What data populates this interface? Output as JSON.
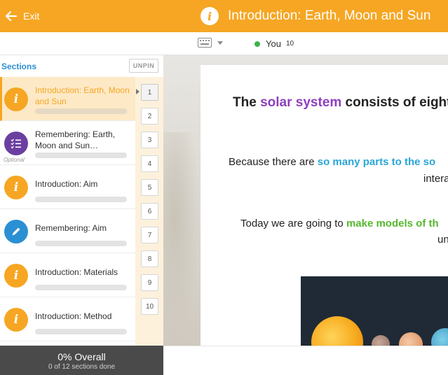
{
  "header": {
    "exit_label": "Exit",
    "title": "Introduction: Earth, Moon and Sun"
  },
  "toolbar": {
    "presence_name": "You",
    "presence_count": "10"
  },
  "sidebar": {
    "heading": "Sections",
    "unpin_label": "UNPIN",
    "items": [
      {
        "label": "Introduction: Earth, Moon and Sun",
        "icon": "info-icon",
        "progress": 0,
        "active": true
      },
      {
        "label": "Remembering: Earth, Moon and Sun…",
        "icon": "checklist-icon",
        "progress": 0,
        "optional_label": "Optional"
      },
      {
        "label": "Introduction: Aim",
        "icon": "info-icon",
        "progress": 0
      },
      {
        "label": "Remembering: Aim",
        "icon": "pencil-icon",
        "progress": 0
      },
      {
        "label": "Introduction: Materials",
        "icon": "info-icon",
        "progress": 0
      },
      {
        "label": "Introduction: Method",
        "icon": "info-icon",
        "progress": 0
      }
    ],
    "pages": [
      "1",
      "2",
      "3",
      "4",
      "5",
      "6",
      "7",
      "8",
      "9",
      "10"
    ],
    "current_page": "1"
  },
  "slide": {
    "heading_pre": "The ",
    "heading_highlight": "solar system",
    "heading_post": " consists of eight p",
    "line2_pre": "Because there are ",
    "line2_highlight": "so many parts to the so",
    "line3": "intera",
    "line4_pre": "Today we are going to ",
    "line4_highlight": "make models of th",
    "line5": "un"
  },
  "footer": {
    "overall_label": "0% Overall",
    "sections_done": "0 of 12 sections done"
  },
  "colors": {
    "brand_orange": "#f6a623",
    "accent_blue": "#2b8fd4",
    "quiz_purple": "#6b3fa0",
    "online_green": "#3bb54a",
    "highlight_purple": "#8e3fbf",
    "highlight_blue": "#2aa6d6",
    "highlight_green": "#57b82f"
  }
}
